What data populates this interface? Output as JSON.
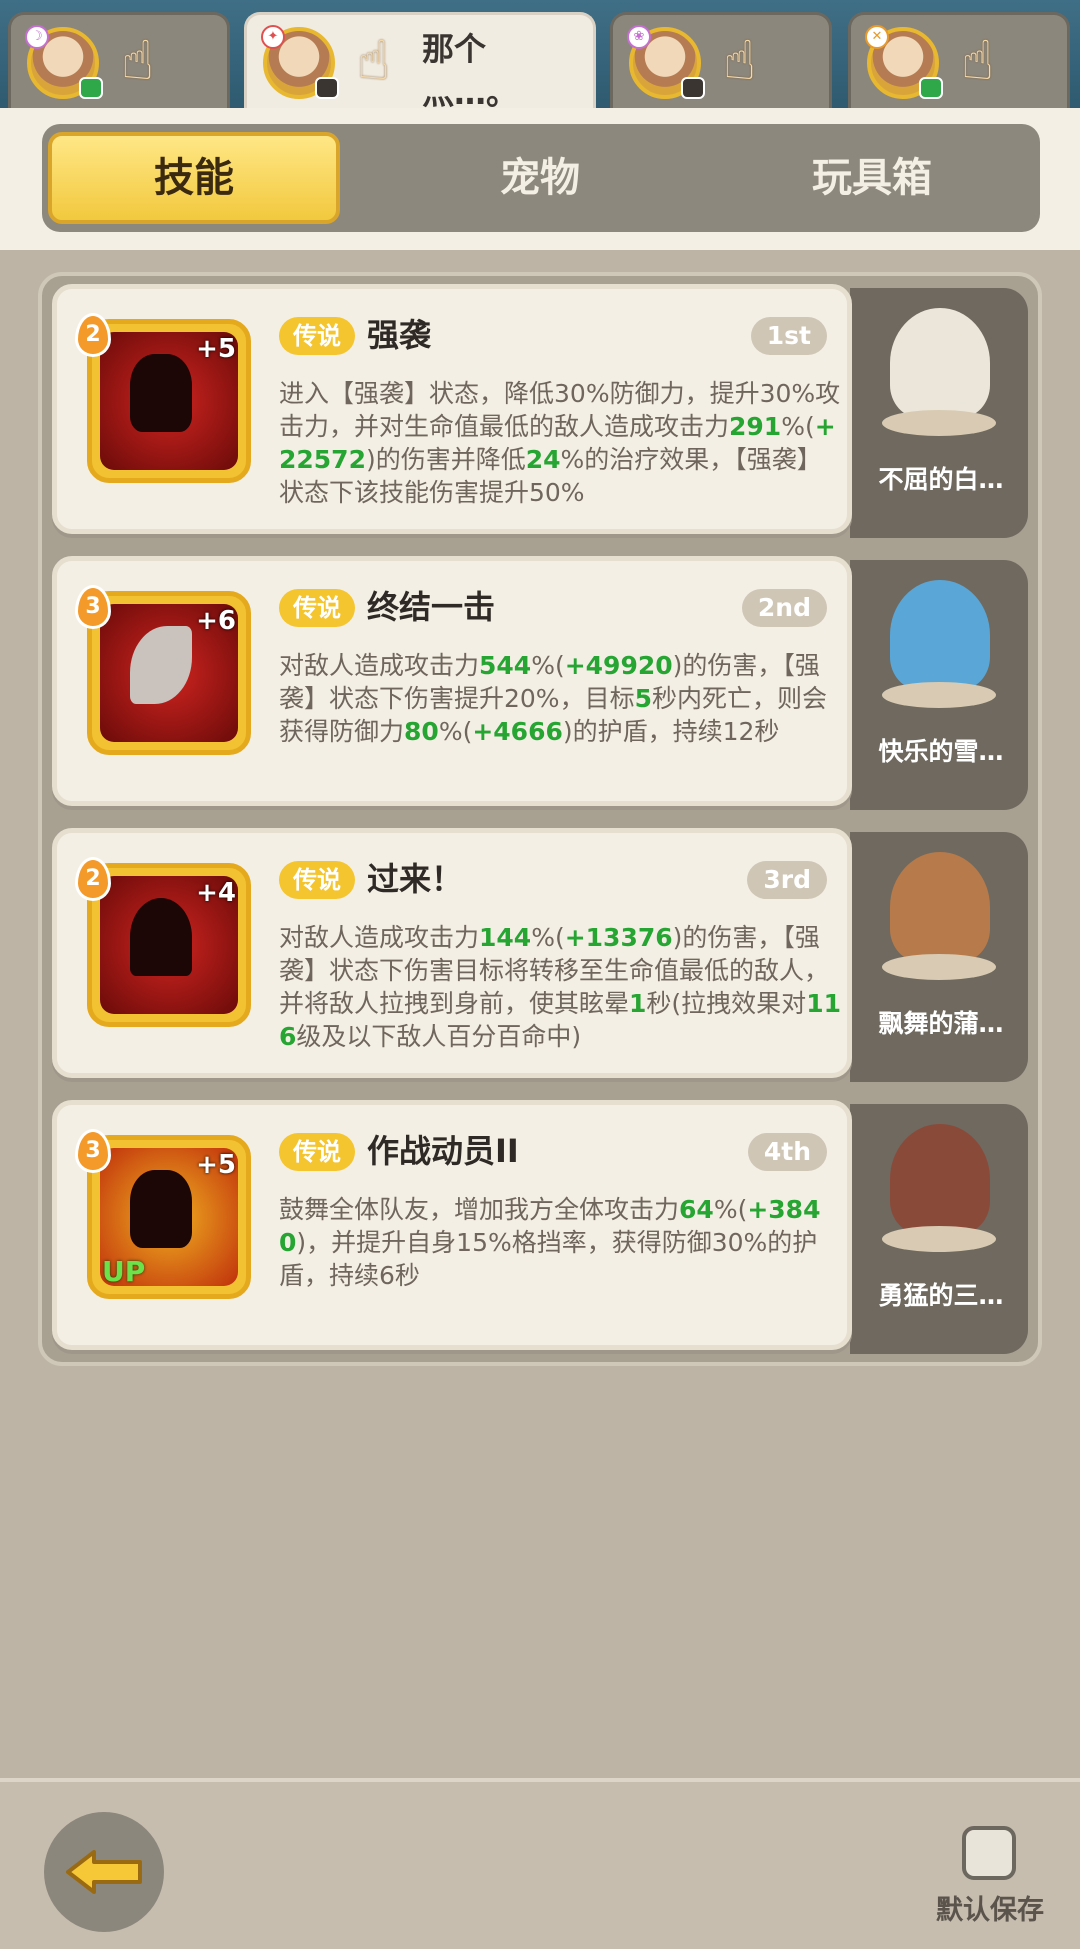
{
  "hero_tabs": [
    {
      "name": "",
      "element": "☽",
      "active": false
    },
    {
      "name": "那个灬…。",
      "element": "✦",
      "active": true
    },
    {
      "name": "",
      "element": "❀",
      "active": false
    },
    {
      "name": "",
      "element": "✕",
      "active": false
    }
  ],
  "tabs": [
    {
      "label": "技能",
      "active": true
    },
    {
      "label": "宠物",
      "active": false
    },
    {
      "label": "玩具箱",
      "active": false
    }
  ],
  "skills": [
    {
      "cost": "2",
      "plus": "+5",
      "up": "",
      "rarity": "传说",
      "name": "强袭",
      "rank": "1st",
      "description_parts": [
        {
          "t": "进入【强袭】状态，降低30%防御力，提升30%攻击力，并对生命值最低的敌人造成攻击力"
        },
        {
          "t": "291",
          "g": true
        },
        {
          "t": "%("
        },
        {
          "t": "+22572",
          "g": true
        },
        {
          "t": ")的伤害并降低"
        },
        {
          "t": "24",
          "g": true
        },
        {
          "t": "%的治疗效果，【强袭】状态下该技能伤害提升50%"
        }
      ],
      "pet_name": "不屈的白…"
    },
    {
      "cost": "3",
      "plus": "+6",
      "up": "",
      "rarity": "传说",
      "name": "终结一击",
      "rank": "2nd",
      "description_parts": [
        {
          "t": "对敌人造成攻击力"
        },
        {
          "t": "544",
          "g": true
        },
        {
          "t": "%("
        },
        {
          "t": "+49920",
          "g": true
        },
        {
          "t": ")的伤害，【强袭】状态下伤害提升20%，目标"
        },
        {
          "t": "5",
          "g": true
        },
        {
          "t": "秒内死亡，则会获得防御力"
        },
        {
          "t": "80",
          "g": true
        },
        {
          "t": "%("
        },
        {
          "t": "+4666",
          "g": true
        },
        {
          "t": ")的护盾，持续12秒"
        }
      ],
      "pet_name": "快乐的雪…"
    },
    {
      "cost": "2",
      "plus": "+4",
      "up": "",
      "rarity": "传说",
      "name": "过来！",
      "rank": "3rd",
      "description_parts": [
        {
          "t": "对敌人造成攻击力"
        },
        {
          "t": "144",
          "g": true
        },
        {
          "t": "%("
        },
        {
          "t": "+13376",
          "g": true
        },
        {
          "t": ")的伤害，【强袭】状态下伤害目标将转移至生命值最低的敌人，并将敌人拉拽到身前，使其眩晕"
        },
        {
          "t": "1",
          "g": true
        },
        {
          "t": "秒(拉拽效果对"
        },
        {
          "t": "116",
          "g": true
        },
        {
          "t": "级及以下敌人百分百命中)"
        }
      ],
      "pet_name": "飘舞的蒲…"
    },
    {
      "cost": "3",
      "plus": "+5",
      "up": "UP",
      "rarity": "传说",
      "name": "作战动员II",
      "rank": "4th",
      "description_parts": [
        {
          "t": "鼓舞全体队友，增加我方全体攻击力"
        },
        {
          "t": "64",
          "g": true
        },
        {
          "t": "%("
        },
        {
          "t": "+3840",
          "g": true
        },
        {
          "t": ")，并提升自身15%格挡率，获得防御30%的护盾，持续6秒"
        }
      ],
      "pet_name": "勇猛的三…"
    }
  ],
  "bottom": {
    "save_label": "默认保存",
    "save_checked": false
  },
  "colors": {
    "accent_yellow": "#f2c93e",
    "highlight_green": "#27a532",
    "panel_bg": "#f4efe5",
    "frame_grey": "#8d887e"
  },
  "icons": {
    "hand": "tap-hand-icon",
    "back": "back-arrow-icon"
  }
}
